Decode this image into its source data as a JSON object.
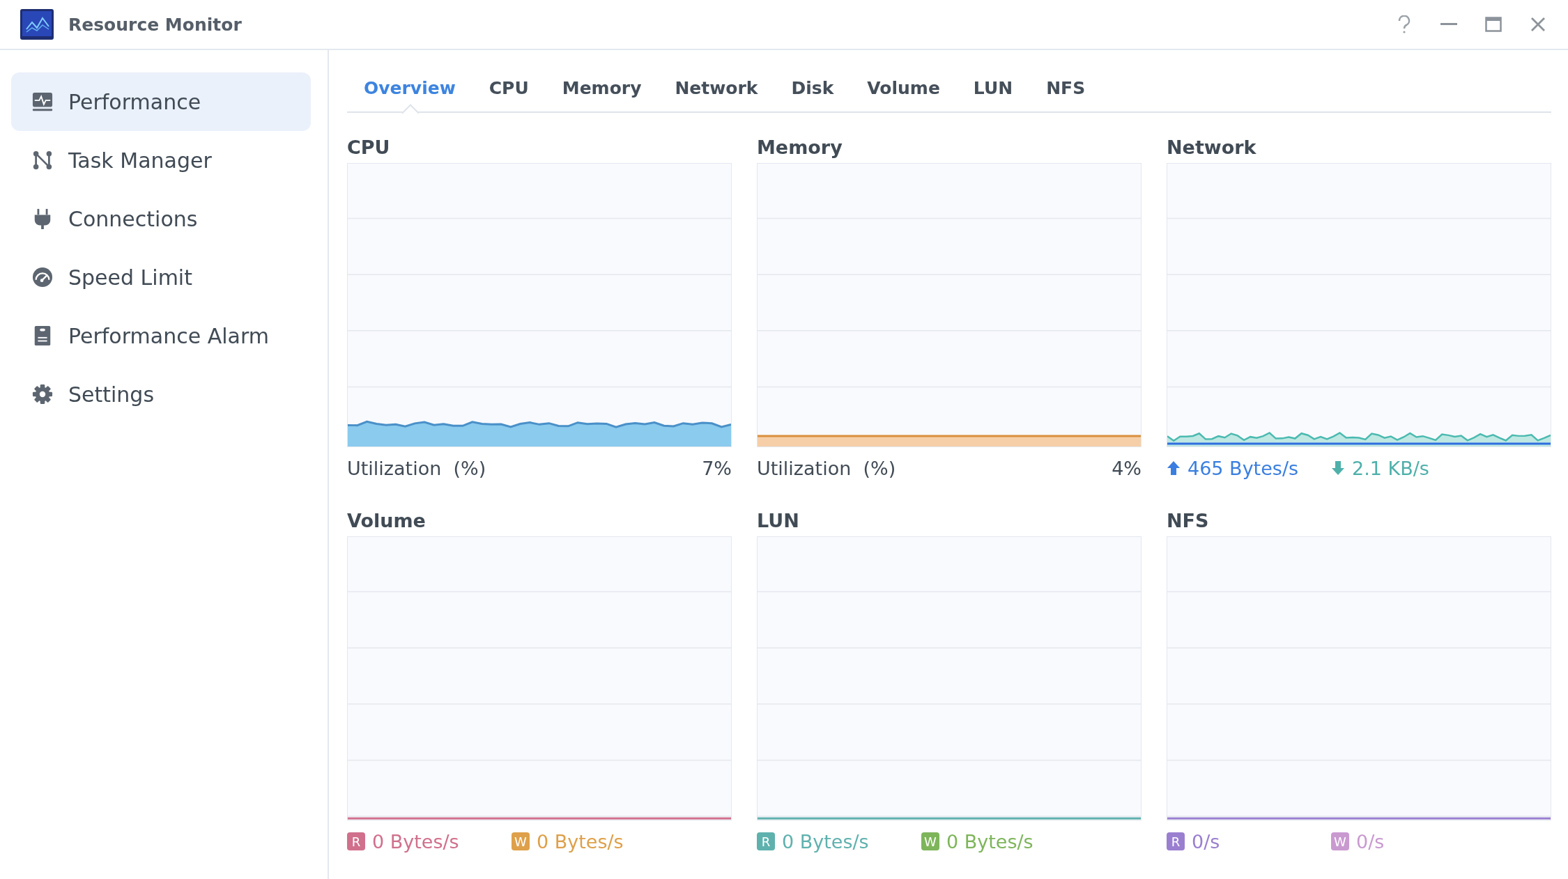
{
  "window": {
    "title": "Resource Monitor"
  },
  "sidebar": {
    "items": [
      {
        "label": "Performance",
        "selected": true
      },
      {
        "label": "Task Manager",
        "selected": false
      },
      {
        "label": "Connections",
        "selected": false
      },
      {
        "label": "Speed Limit",
        "selected": false
      },
      {
        "label": "Performance Alarm",
        "selected": false
      },
      {
        "label": "Settings",
        "selected": false
      }
    ]
  },
  "tabs": [
    {
      "label": "Overview",
      "selected": true
    },
    {
      "label": "CPU",
      "selected": false
    },
    {
      "label": "Memory",
      "selected": false
    },
    {
      "label": "Network",
      "selected": false
    },
    {
      "label": "Disk",
      "selected": false
    },
    {
      "label": "Volume",
      "selected": false
    },
    {
      "label": "LUN",
      "selected": false
    },
    {
      "label": "NFS",
      "selected": false
    }
  ],
  "panels": [
    {
      "title": "CPU",
      "footer": {
        "kind": "utilization",
        "label": "Utilization  (%)",
        "value": "7%"
      }
    },
    {
      "title": "Memory",
      "footer": {
        "kind": "utilization",
        "label": "Utilization  (%)",
        "value": "4%"
      }
    },
    {
      "title": "Network",
      "footer": {
        "kind": "legend",
        "items": [
          {
            "kind": "arrow-up",
            "text": "465 Bytes/s",
            "color": "#3a7fe0"
          },
          {
            "kind": "arrow-down",
            "text": "2.1 KB/s",
            "color": "#4fb0aa"
          }
        ]
      }
    },
    {
      "title": "Volume",
      "footer": {
        "kind": "legend",
        "items": [
          {
            "kind": "badge",
            "badge": "R",
            "text": "0 Bytes/s",
            "color": "#d0708c"
          },
          {
            "kind": "badge",
            "badge": "W",
            "text": "0 Bytes/s",
            "color": "#dea04a"
          }
        ]
      }
    },
    {
      "title": "LUN",
      "footer": {
        "kind": "legend",
        "items": [
          {
            "kind": "badge",
            "badge": "R",
            "text": "0 Bytes/s",
            "color": "#5fb1ae"
          },
          {
            "kind": "badge",
            "badge": "W",
            "text": "0 Bytes/s",
            "color": "#7eb55a"
          }
        ]
      }
    },
    {
      "title": "NFS",
      "footer": {
        "kind": "legend",
        "items": [
          {
            "kind": "badge",
            "badge": "R",
            "text": "0/s",
            "color": "#9a7fd0"
          },
          {
            "kind": "badge",
            "badge": "W",
            "text": "0/s",
            "color": "#c99ad0"
          }
        ]
      }
    }
  ]
}
